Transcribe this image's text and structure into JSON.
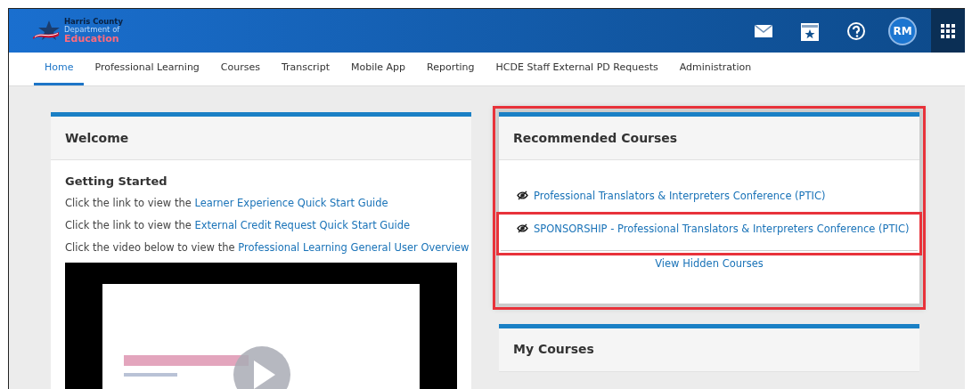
{
  "logo": {
    "lines": [
      "Harris County",
      "Department of",
      "Education"
    ]
  },
  "header": {
    "avatar": "RM"
  },
  "nav": [
    {
      "label": "Home",
      "selected": true
    },
    {
      "label": "Professional Learning",
      "selected": false
    },
    {
      "label": "Courses",
      "selected": false
    },
    {
      "label": "Transcript",
      "selected": false
    },
    {
      "label": "Mobile App",
      "selected": false
    },
    {
      "label": "Reporting",
      "selected": false
    },
    {
      "label": "HCDE Staff External PD Requests",
      "selected": false
    },
    {
      "label": "Administration",
      "selected": false
    }
  ],
  "welcome": {
    "title": "Welcome",
    "subtitle": "Getting Started",
    "lines": [
      {
        "text": "Click the link to view the ",
        "link": "Learner Experience Quick Start Guide"
      },
      {
        "text": "Click the link to view the ",
        "link": "External Credit Request Quick Start Guide"
      },
      {
        "text": "Click the video below to view the ",
        "link": "Professional Learning General User Overview"
      }
    ]
  },
  "recommended": {
    "title": "Recommended Courses",
    "highlighted": true,
    "courses": [
      {
        "title": "Professional Translators & Interpreters Conference (PTIC)",
        "highlighted": false
      },
      {
        "title": "SPONSORSHIP - Professional Translators & Interpreters Conference (PTIC)",
        "highlighted": true
      }
    ],
    "footer_link": "View Hidden Courses"
  },
  "my_courses": {
    "title": "My Courses"
  }
}
